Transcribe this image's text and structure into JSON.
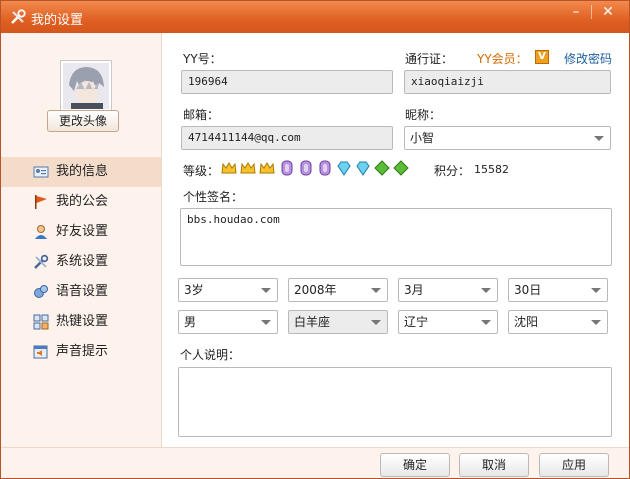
{
  "window": {
    "title": "我的设置",
    "minimize": "–",
    "close": "✕"
  },
  "sidebar": {
    "change_avatar": "更改头像",
    "items": [
      {
        "label": "我的信息",
        "icon": "id-card-icon"
      },
      {
        "label": "我的公会",
        "icon": "flag-icon"
      },
      {
        "label": "好友设置",
        "icon": "person-icon"
      },
      {
        "label": "系统设置",
        "icon": "wrench-icon"
      },
      {
        "label": "语音设置",
        "icon": "voice-icon"
      },
      {
        "label": "热键设置",
        "icon": "keyboard-icon"
      },
      {
        "label": "声音提示",
        "icon": "speaker-icon"
      }
    ]
  },
  "form": {
    "yy_label": "YY号：",
    "yy_value": "196964",
    "vip_label": "YY会员：",
    "vip_badge": "V",
    "passport_label": "通行证：",
    "passport_value": "xiaoqiaizji",
    "change_password": "修改密码",
    "email_label": "邮箱：",
    "email_value": "4714411144@qq.com",
    "nickname_label": "昵称：",
    "nickname_value": "小智",
    "level_label": "等级：",
    "points_label": "积分：",
    "points_value": "15582",
    "signature_label": "个性签名：",
    "signature_value": "bbs.houdao.com",
    "age": "3岁",
    "year": "2008年",
    "month": "3月",
    "day": "30日",
    "gender": "男",
    "zodiac": "白羊座",
    "province": "辽宁",
    "city": "沈阳",
    "description_label": "个人说明："
  },
  "footer": {
    "ok": "确定",
    "cancel": "取消",
    "apply": "应用"
  },
  "colors": {
    "titlebar": "#e06022",
    "accent_link": "#1d5f9c",
    "vip": "#d26a00"
  }
}
